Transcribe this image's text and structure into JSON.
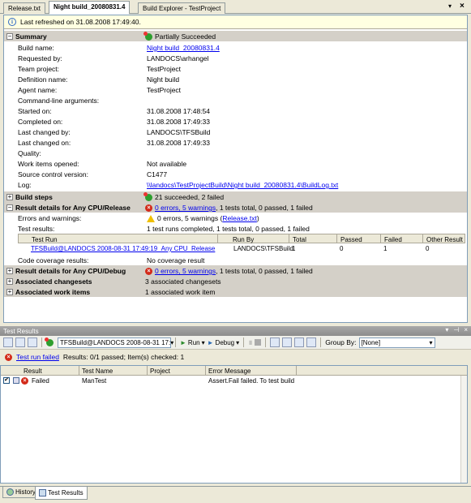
{
  "doc_tabs": [
    {
      "label": "Release.txt"
    },
    {
      "label": "Night build_20080831.4"
    },
    {
      "label": "Build Explorer - TestProject"
    }
  ],
  "refresh_text": "Last refreshed on 31.08.2008 17:49:40.",
  "summary": {
    "title": "Summary",
    "status": "Partially Succeeded",
    "fields": [
      {
        "label": "Build name:",
        "value": "Night build_20080831.4",
        "link": true
      },
      {
        "label": "Requested by:",
        "value": "LANDOCS\\arhangel"
      },
      {
        "label": "Team project:",
        "value": "TestProject"
      },
      {
        "label": "Definition name:",
        "value": "Night build"
      },
      {
        "label": "Agent name:",
        "value": "TestProject"
      },
      {
        "label": "Command-line arguments:",
        "value": ""
      },
      {
        "label": "Started on:",
        "value": "31.08.2008 17:48:54"
      },
      {
        "label": "Completed on:",
        "value": "31.08.2008 17:49:33"
      },
      {
        "label": "Last changed by:",
        "value": "LANDOCS\\TFSBuild"
      },
      {
        "label": "Last changed on:",
        "value": "31.08.2008 17:49:33"
      },
      {
        "label": "Quality:",
        "value": ""
      },
      {
        "label": "Work items opened:",
        "value": "Not available"
      },
      {
        "label": "Source control version:",
        "value": "C1477"
      },
      {
        "label": "Log:",
        "value": "\\\\landocs\\TestProjectBuild\\Night build_20080831.4\\BuildLog.txt",
        "link": true
      }
    ]
  },
  "build_steps": {
    "title": "Build steps",
    "value": "21 succeeded, 2 failed"
  },
  "result_release": {
    "title": "Result details for Any CPU/Release",
    "errors_link": "0 errors, 5 warnings",
    "summary_rest": ", 1 tests total, 0 passed, 1 failed",
    "errors_label": "Errors and warnings:",
    "errors_text": "0 errors, 5 warnings (",
    "errors_file": "Release.txt",
    "errors_close": ")",
    "test_results_label": "Test results:",
    "test_results_value": "1 test runs completed, 1 tests total, 0 passed, 1 failed",
    "grid_headers": [
      "Test Run",
      "Run By",
      "Total",
      "Passed",
      "Failed",
      "Other Result"
    ],
    "grid_row": [
      "TFSBuild@LANDOCS 2008-08-31 17:49:19_Any CPU_Release",
      "LANDOCS\\TFSBuild",
      "1",
      "0",
      "1",
      "0"
    ],
    "coverage_label": "Code coverage results:",
    "coverage_value": "No coverage result"
  },
  "result_debug": {
    "title": "Result details for Any CPU/Debug",
    "errors_link": "0 errors, 5 warnings",
    "summary_rest": ", 1 tests total, 0 passed, 1 failed"
  },
  "changesets": {
    "title": "Associated changesets",
    "value": "3 associated changesets"
  },
  "work_items": {
    "title": "Associated work items",
    "value": "1 associated work item"
  },
  "test_results_window": {
    "title": "Test Results",
    "run_combo": "TFSBuild@LANDOCS 2008-08-31 17:",
    "run_label": "Run",
    "debug_label": "Debug",
    "group_by_label": "Group By:",
    "group_by_value": "[None]",
    "status_link": "Test run failed",
    "status_text": "Results: 0/1 passed;  Item(s) checked: 1",
    "headers": [
      "Result",
      "Test Name",
      "Project",
      "Error Message"
    ],
    "row": {
      "result": "Failed",
      "test_name": "ManTest",
      "project": "",
      "error": "Assert.Fail failed. To test build f"
    }
  },
  "tool_tabs": [
    {
      "label": "History"
    },
    {
      "label": "Test Results"
    }
  ]
}
